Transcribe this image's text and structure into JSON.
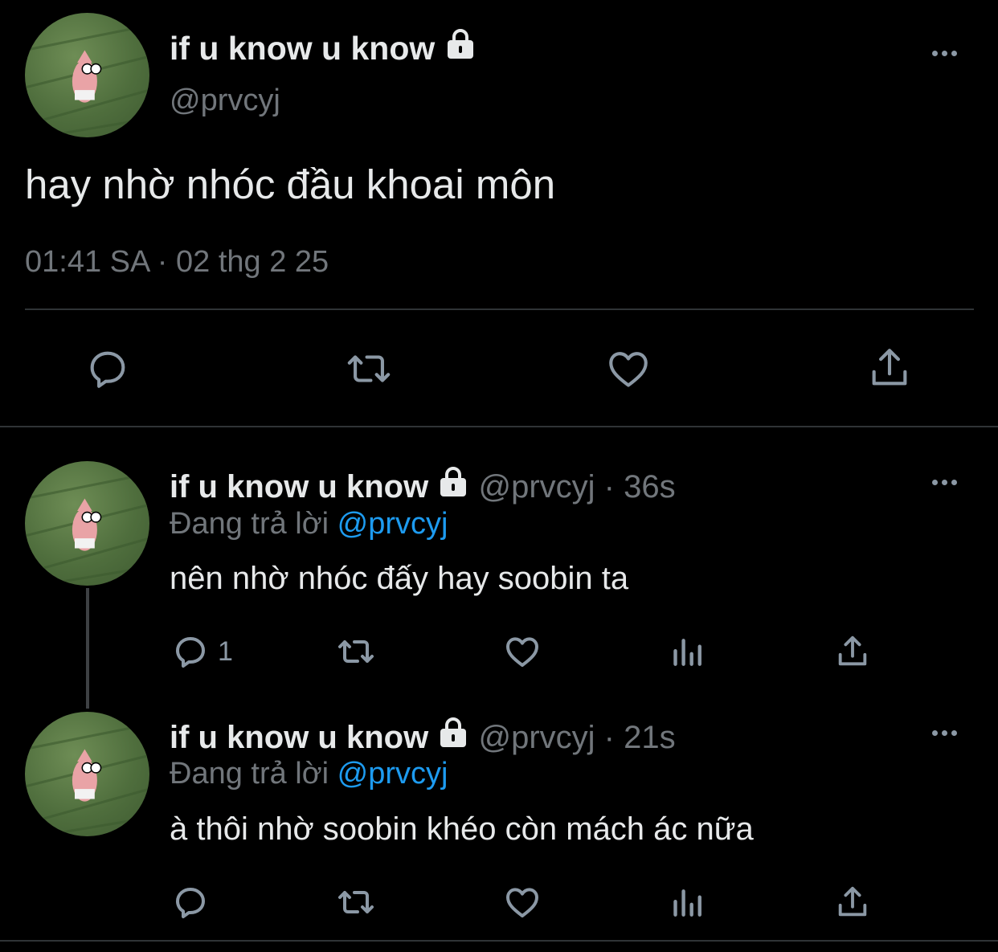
{
  "main_tweet": {
    "display_name": "if u know u know",
    "handle": "@prvcyj",
    "text": "hay nhờ nhóc đầu khoai môn",
    "timestamp": "01:41 SA · 02 thg 2 25",
    "actions": [
      "reply-icon",
      "retweet-icon",
      "like-icon",
      "share-icon"
    ]
  },
  "replies": [
    {
      "display_name": "if u know u know",
      "handle": "@prvcyj",
      "time": "36s",
      "replying_label": "Đang trả lời",
      "replying_to": "@prvcyj",
      "text": "nên nhờ nhóc đấy hay soobin ta",
      "reply_count": "1"
    },
    {
      "display_name": "if u know u know",
      "handle": "@prvcyj",
      "time": "21s",
      "replying_label": "Đang trả lời",
      "replying_to": "@prvcyj",
      "text": "à thôi nhờ soobin khéo còn mách ác nữa",
      "reply_count": ""
    }
  ],
  "separator": "·",
  "colors": {
    "background": "#000000",
    "text": "#e7e9ea",
    "muted": "#71767b",
    "link": "#1d9bf0",
    "icon": "#8b98a5"
  }
}
